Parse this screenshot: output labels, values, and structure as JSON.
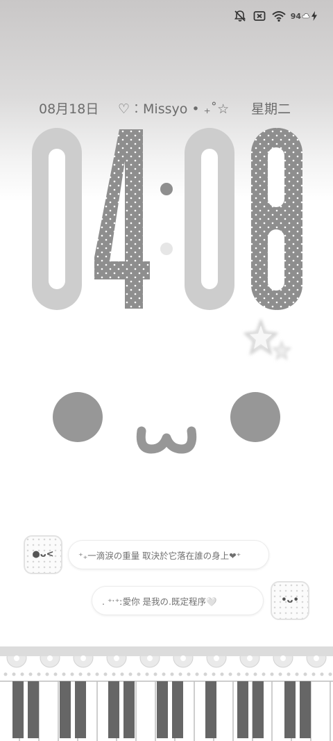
{
  "status_bar": {
    "icons": [
      "muted-bell-icon",
      "no-sim-icon",
      "wifi-icon"
    ],
    "battery_level": "94",
    "charging": true
  },
  "info_line": {
    "date": "08月18日",
    "signature": "♡︰Missyo • ₊˚☆",
    "weekday": "星期二"
  },
  "clock": {
    "hours": "04",
    "minutes": "08"
  },
  "chat": {
    "messages": [
      {
        "avatar_face": "●ᴗ<",
        "text": "⁺₊一滴淚の重量 取決於它落在誰の身上❤⁺"
      },
      {
        "avatar_face": "•ᴗ•",
        "text": ". ⁺ˑ⁺ː愛你 是我の.既定程序🤍"
      }
    ]
  },
  "colors": {
    "digit_solid": "#cdcdcd",
    "digit_dotted": "#8e8e8e",
    "eye": "#979797",
    "text": "#6c6c6c"
  }
}
